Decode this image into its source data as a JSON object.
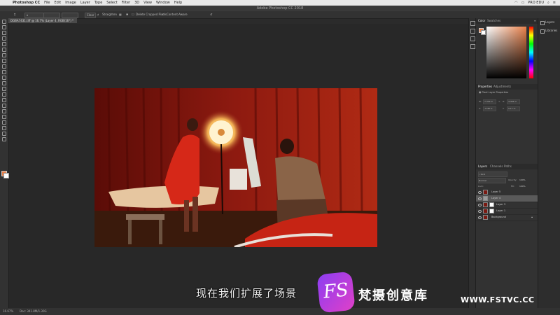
{
  "menubar": {
    "app": "Photoshop CC",
    "menus": [
      "Photoshop CC",
      "File",
      "Edit",
      "Image",
      "Layer",
      "Type",
      "Select",
      "Filter",
      "3D",
      "View",
      "Window",
      "Help"
    ],
    "right_label": "PRO EDU"
  },
  "window": {
    "title": "Adobe Photoshop CC 2018"
  },
  "options": {
    "clear": "Clear",
    "straighten": "Straighten",
    "delete_cropped": "Delete Cropped Pixels",
    "content_aware": "Content-Aware"
  },
  "document": {
    "tab": "DGBA7431.tiff @ 16.7% (Layer 4, RGB/16*) *"
  },
  "panels": {
    "color_tab": "Color",
    "swatches_tab": "Swatches",
    "properties_tab": "Properties",
    "adjustments_tab": "Adjustments",
    "pixel_layer": "Pixel Layer Properties",
    "w_label": "W:",
    "w_value": "7,312 in",
    "h_label": "H:",
    "h_value": "4,491 in",
    "x_label": "X:",
    "x_value": "-0.48 in",
    "y_label": "Y:",
    "y_value": "14.7 in",
    "layers_tab": "Layers",
    "channels_tab": "Channels",
    "paths_tab": "Paths",
    "kind_label": "Kind",
    "blend_mode": "Normal",
    "opacity_label": "Opacity:",
    "opacity_value": "100%",
    "lock_label": "Lock:",
    "fill_label": "Fill:",
    "fill_value": "100%"
  },
  "layers": [
    {
      "name": "Layer 5",
      "selected": false,
      "mask": false
    },
    {
      "name": "Layer 4",
      "selected": true,
      "mask": false
    },
    {
      "name": "Layer 3",
      "selected": false,
      "mask": true
    },
    {
      "name": "Layer 1",
      "selected": false,
      "mask": true
    },
    {
      "name": "Background",
      "selected": false,
      "mask": false
    }
  ],
  "sidepanel": {
    "item1": "Layers",
    "item2": "Libraries"
  },
  "status": {
    "zoom": "16.67%",
    "doc": "Doc: 341.8M/1.30G"
  },
  "subtitle": "现在我们扩展了场景",
  "watermark": {
    "logo": "FS",
    "text": "梵摄创意库",
    "url": "WWW.FSTVC.CC"
  },
  "colors": {
    "accent": "#e8804a",
    "curtain": "#8e1a10"
  }
}
